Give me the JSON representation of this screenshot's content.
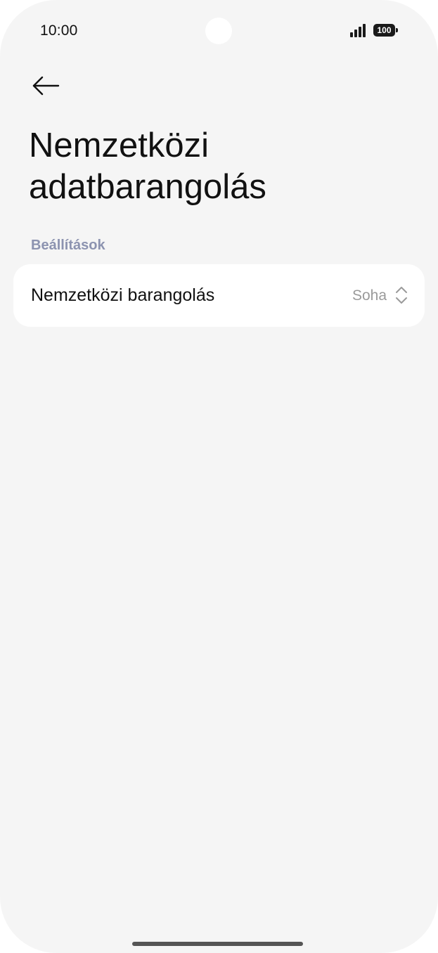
{
  "status_bar": {
    "time": "10:00",
    "battery": "100",
    "signal_icon": "signal-icon"
  },
  "header": {
    "back_icon": "back-arrow-icon",
    "title": "Nemzetközi adatbarangolás"
  },
  "section": {
    "title": "Beállítások"
  },
  "settings": {
    "items": [
      {
        "label": "Nemzetközi barangolás",
        "value": "Soha",
        "icon": "chevron-updown-icon"
      }
    ]
  },
  "colors": {
    "background": "#f5f5f5",
    "card": "#ffffff",
    "section_header": "#8c93b0",
    "secondary_text": "#9a9a9a"
  }
}
